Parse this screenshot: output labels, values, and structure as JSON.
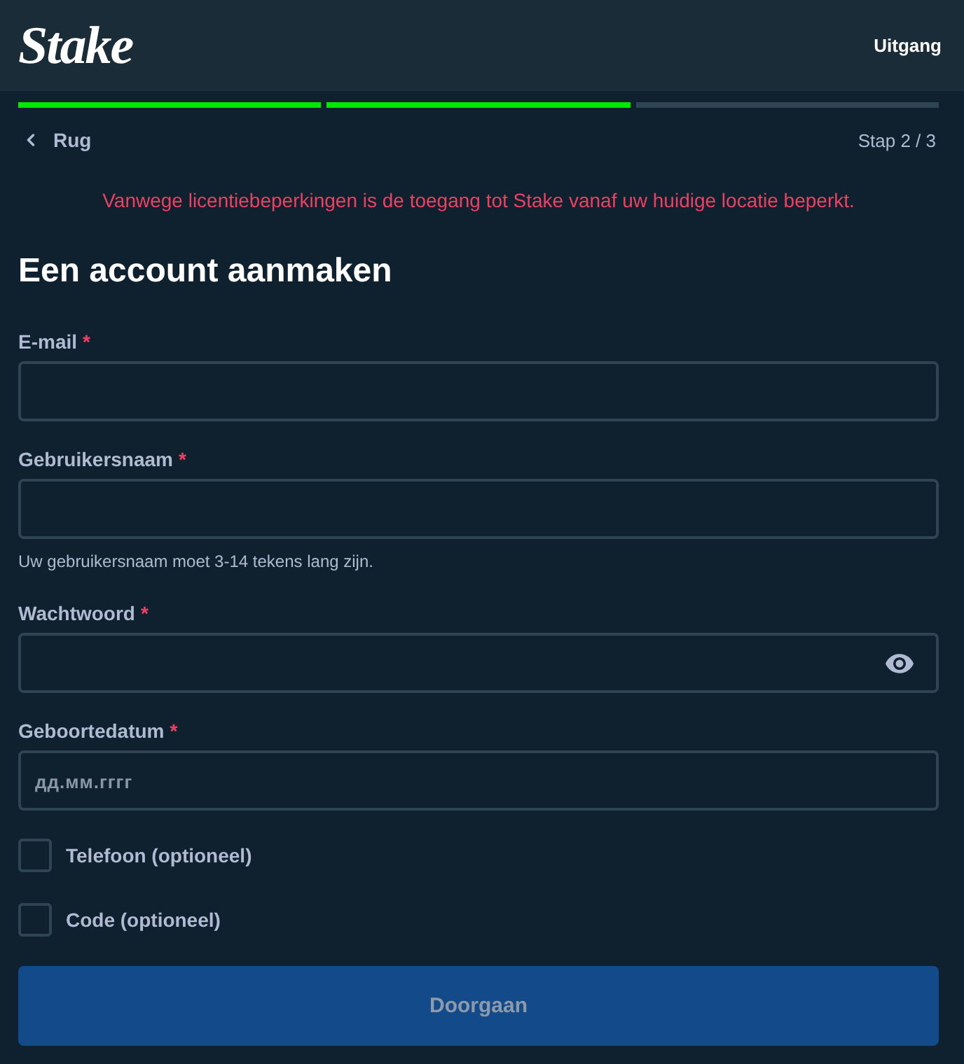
{
  "header": {
    "logo": "Stake",
    "exit_link": "Uitgang"
  },
  "progress": {
    "steps": [
      {
        "completed": true
      },
      {
        "completed": true
      },
      {
        "completed": false
      }
    ]
  },
  "nav": {
    "back": "Rug",
    "step": "Stap 2 / 3"
  },
  "alert": "Vanwege licentiebeperkingen is de toegang tot Stake vanaf uw huidige locatie beperkt.",
  "title": "Een account aanmaken",
  "fields": [
    {
      "kind": "text",
      "label": "E-mail",
      "required_mark": "*"
    },
    {
      "kind": "text",
      "label": "Gebruikersnaam",
      "required_mark": "*",
      "hint": "Uw gebruikersnaam moet 3-14 tekens lang zijn."
    },
    {
      "kind": "password",
      "label": "Wachtwoord",
      "required_mark": "*"
    },
    {
      "kind": "date",
      "label": "Geboortedatum",
      "required_mark": "*",
      "placeholder": "дд.мм.гггг"
    }
  ],
  "options": [
    {
      "label": "Telefoon (optioneel)",
      "checked": false
    },
    {
      "label": "Code (optioneel)",
      "checked": false
    }
  ],
  "submit": {
    "label": "Doorgaan",
    "disabled": true
  }
}
